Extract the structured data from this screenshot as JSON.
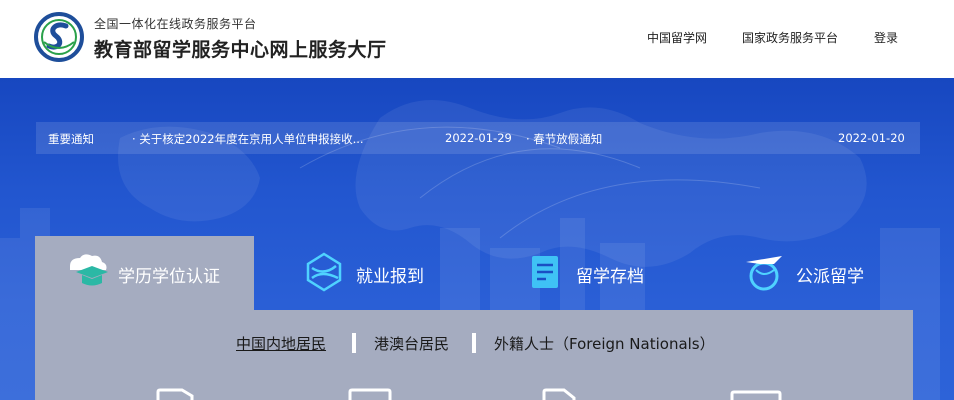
{
  "header": {
    "brand_sub": "全国一体化在线政务服务平台",
    "brand_main": "教育部留学服务中心网上服务大厅",
    "nav": [
      "中国留学网",
      "国家政务服务平台",
      "登录"
    ]
  },
  "notice": {
    "label": "重要通知",
    "items": [
      {
        "title": "· 关于核定2022年度在京用人单位申报接收...",
        "date": "2022-01-29"
      },
      {
        "title": "· 春节放假通知",
        "date": "2022-01-20"
      }
    ]
  },
  "tabs": [
    {
      "label": "学历学位认证",
      "icon": "graduation-cap-icon",
      "active": true
    },
    {
      "label": "就业报到",
      "icon": "globe-icon"
    },
    {
      "label": "留学存档",
      "icon": "document-icon"
    },
    {
      "label": "公派留学",
      "icon": "plane-globe-icon"
    }
  ],
  "subtabs": [
    "中国内地居民",
    "港澳台居民",
    "外籍人士（Foreign Nationals）"
  ],
  "colors": {
    "hero_blue": "#1a4fc4",
    "panel_gray": "#a5acc0",
    "logo_blue": "#1e4e9a",
    "logo_green": "#2aa14a"
  }
}
